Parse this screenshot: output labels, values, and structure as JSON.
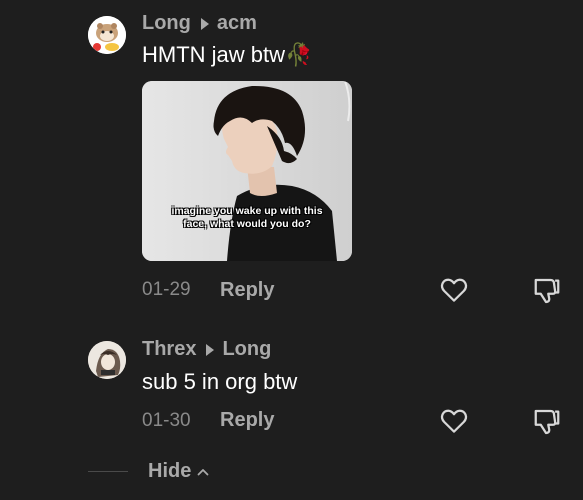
{
  "comments": [
    {
      "author": "Long",
      "reply_to": "acm",
      "text": "HMTN jaw btw🥀",
      "image_caption": "imagine you wake up with this face, what would you do?",
      "date": "01-29",
      "reply_label": "Reply"
    },
    {
      "author": "Threx",
      "reply_to": "Long",
      "text": "sub 5 in org btw",
      "date": "01-30",
      "reply_label": "Reply"
    }
  ],
  "hide_label": "Hide",
  "icons": {
    "like": "heart-outline-icon",
    "dislike": "thumbs-down-icon",
    "reply_arrow": "caret-right-icon",
    "collapse": "chevron-up-icon"
  }
}
